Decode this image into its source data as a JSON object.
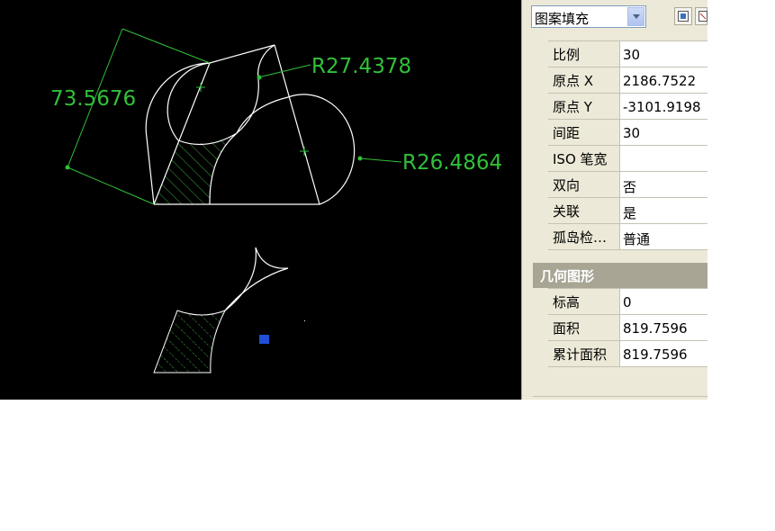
{
  "drawing": {
    "dimension_aligned": "73.5676",
    "radius_top": "R27.4378",
    "radius_right": "R26.4864",
    "colors": {
      "background": "#000000",
      "geometry": "#ffffff",
      "dimension": "#31c03a",
      "grip": "#1f4fd8"
    }
  },
  "properties": {
    "object_type": "图案填充",
    "pattern_rows": [
      {
        "label": "比例",
        "value": "30"
      },
      {
        "label": "原点 X",
        "value": "2186.7522"
      },
      {
        "label": "原点 Y",
        "value": "-3101.9198"
      },
      {
        "label": "间距",
        "value": "30"
      },
      {
        "label": "ISO 笔宽",
        "value": ""
      },
      {
        "label": "双向",
        "value": "否"
      },
      {
        "label": "关联",
        "value": "是"
      },
      {
        "label": "孤岛检…",
        "value": "普通"
      }
    ],
    "geometry_section": "几何图形",
    "geometry_rows": [
      {
        "label": "标高",
        "value": "0"
      },
      {
        "label": "面积",
        "value": "819.7596"
      },
      {
        "label": "累计面积",
        "value": "819.7596"
      }
    ]
  }
}
